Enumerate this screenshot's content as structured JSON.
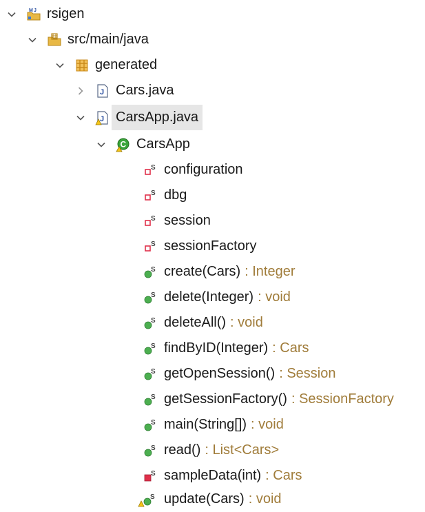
{
  "tree": {
    "project": {
      "label": "rsigen",
      "icon": "java-project-icon"
    },
    "source_folder": {
      "label": "src/main/java",
      "icon": "source-folder-icon"
    },
    "package": {
      "label": "generated",
      "icon": "package-icon"
    },
    "files": [
      {
        "label": "Cars.java",
        "icon": "java-file-icon",
        "expanded": false
      },
      {
        "label": "CarsApp.java",
        "icon": "java-file-warning-icon",
        "expanded": true,
        "selected": true
      }
    ],
    "class": {
      "label": "CarsApp",
      "icon": "class-icon"
    },
    "fields": [
      {
        "label": "configuration",
        "icon": "private-static-field-icon"
      },
      {
        "label": "dbg",
        "icon": "private-static-field-icon"
      },
      {
        "label": "session",
        "icon": "private-static-field-icon"
      },
      {
        "label": "sessionFactory",
        "icon": "private-static-field-icon"
      }
    ],
    "methods": [
      {
        "label": "create(Cars)",
        "type": ": Integer",
        "icon": "public-static-method-icon"
      },
      {
        "label": "delete(Integer)",
        "type": ": void",
        "icon": "public-static-method-icon"
      },
      {
        "label": "deleteAll()",
        "type": ": void",
        "icon": "public-static-method-icon"
      },
      {
        "label": "findByID(Integer)",
        "type": ": Cars",
        "icon": "public-static-method-icon"
      },
      {
        "label": "getOpenSession()",
        "type": ": Session",
        "icon": "public-static-method-icon"
      },
      {
        "label": "getSessionFactory()",
        "type": ": SessionFactory",
        "icon": "public-static-method-icon"
      },
      {
        "label": "main(String[])",
        "type": ": void",
        "icon": "public-static-method-icon"
      },
      {
        "label": "read()",
        "type": ": List<Cars>",
        "icon": "public-static-method-icon"
      },
      {
        "label": "sampleData(int)",
        "type": ": Cars",
        "icon": "private-static-method-icon"
      },
      {
        "label": "update(Cars)",
        "type": ": void",
        "icon": "public-static-method-warning-icon"
      }
    ]
  },
  "colors": {
    "type_annotation": "#a07c3a",
    "selection_bg": "#e6e6e6",
    "public_method": "#4caf50",
    "private_member": "#e0304a",
    "package": "#c98a1a"
  }
}
